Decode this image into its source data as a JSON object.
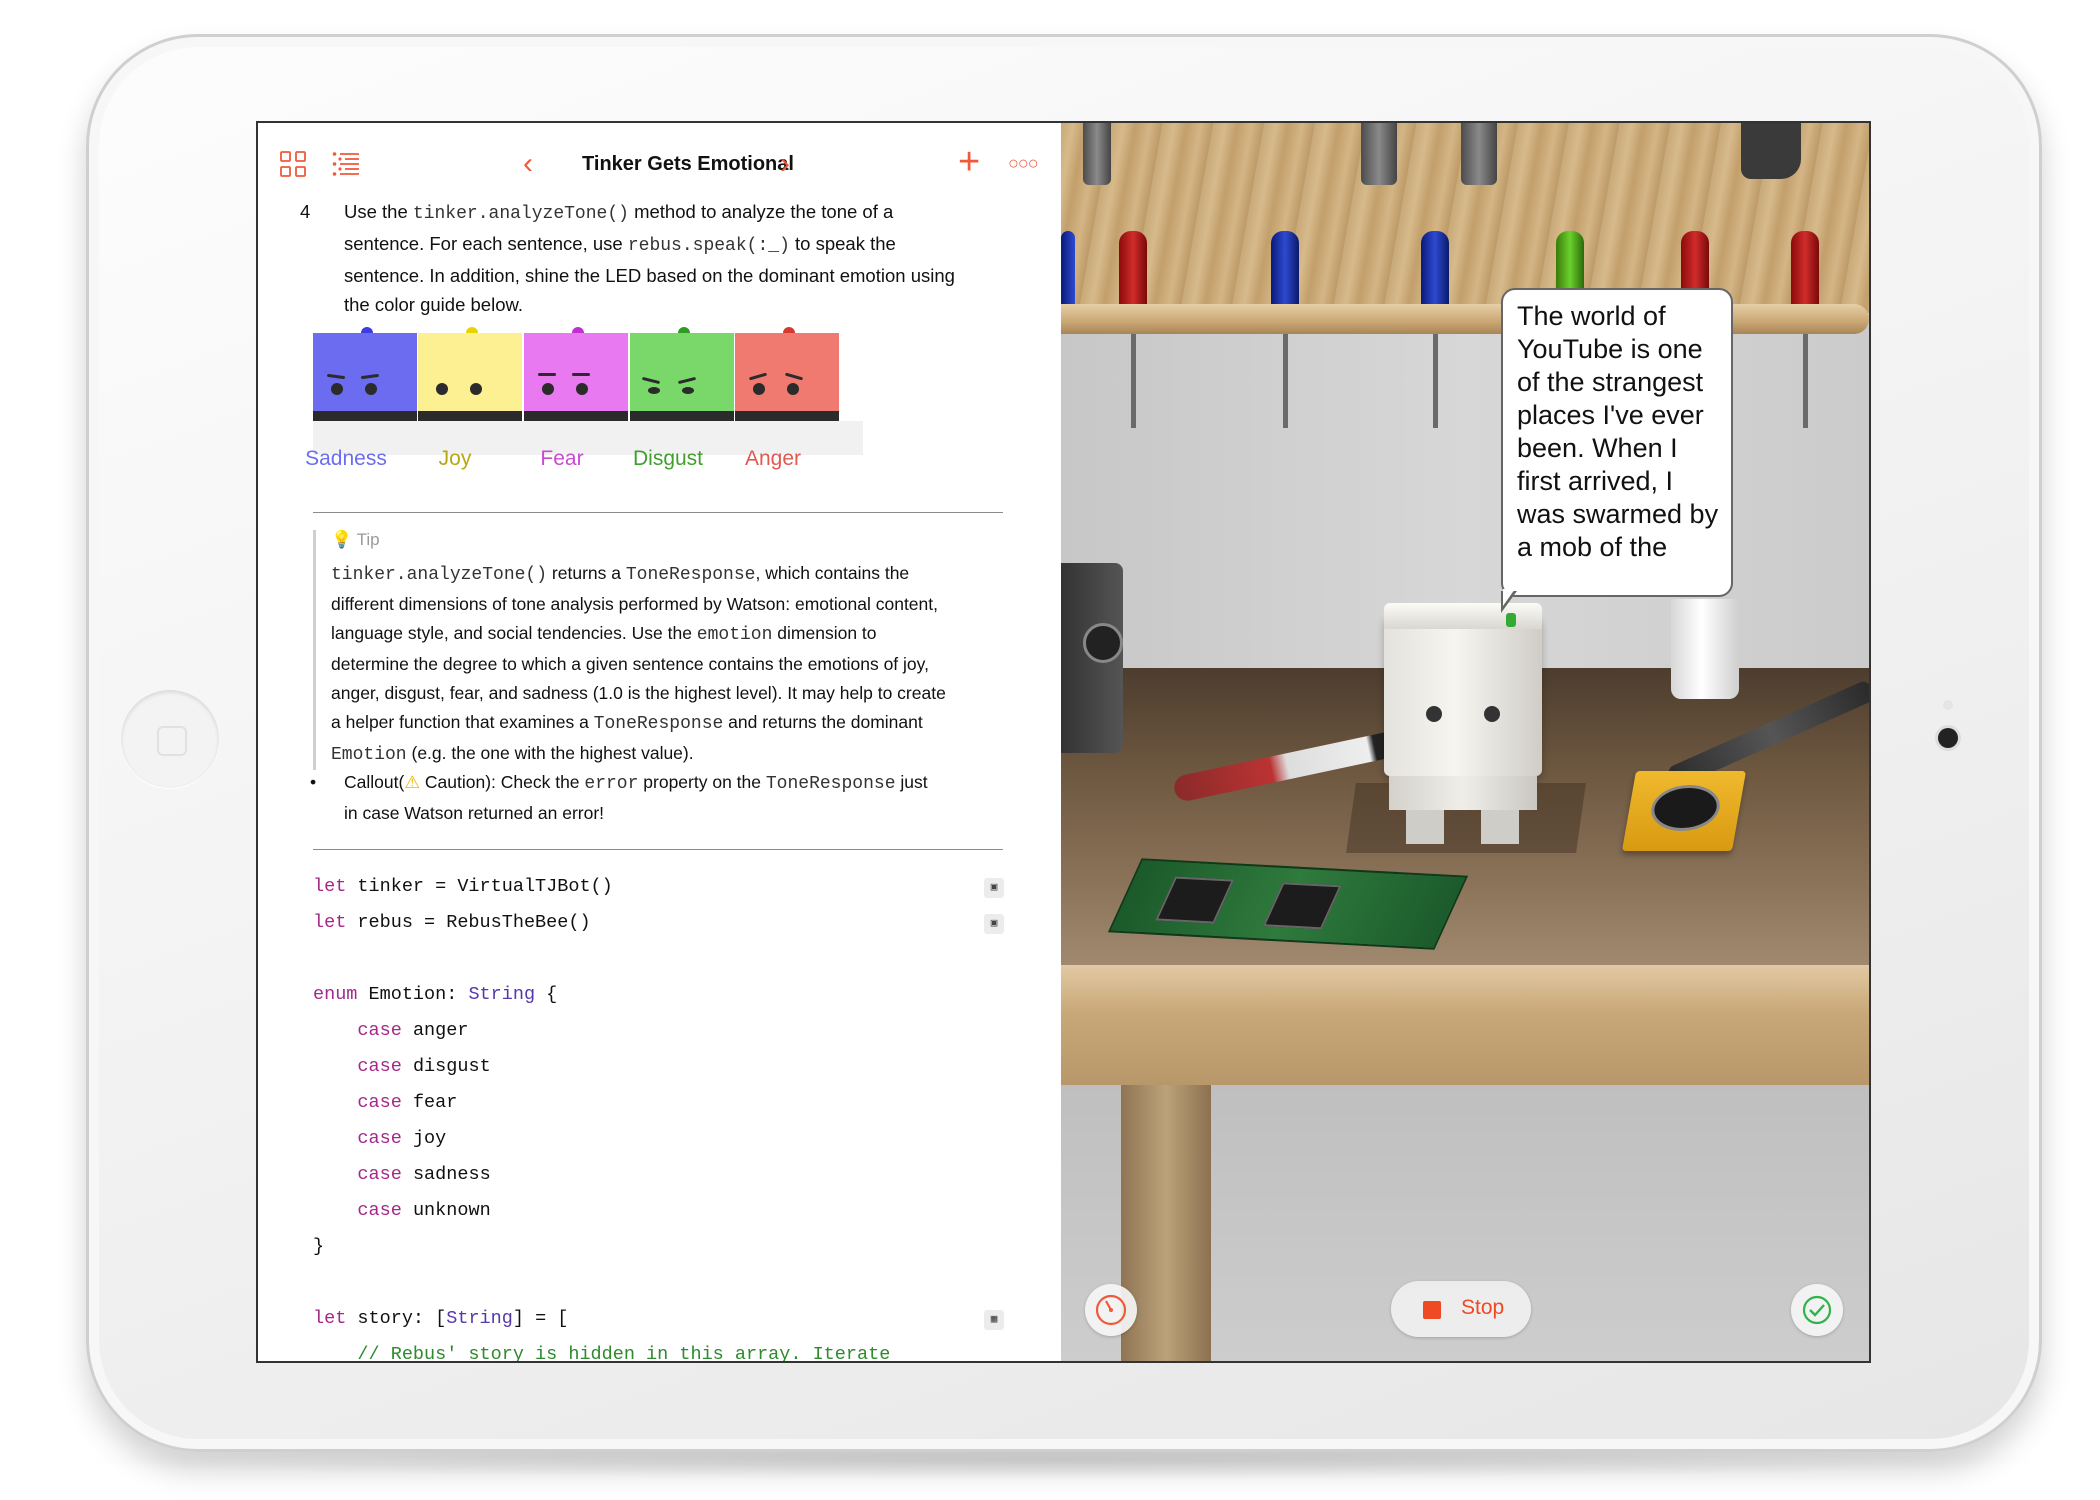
{
  "toolbar": {
    "title": "Tinker Gets Emotional",
    "icons": [
      "grid-icon",
      "list-icon",
      "chevron-left-icon",
      "chevron-right-icon",
      "plus-icon",
      "more-icon"
    ]
  },
  "step": {
    "number": "4",
    "line1_a": "Use the ",
    "line1_code": "tinker.analyzeTone()",
    "line1_b": " method to analyze the tone of a",
    "line2_a": "sentence. For each sentence, use ",
    "line2_code": "rebus.speak(:_)",
    "line2_b": " to speak the",
    "line3": "sentence. In addition, shine the LED based on the dominant emotion using",
    "line4": "the color guide below."
  },
  "emotions": [
    {
      "label": "Sadness",
      "color": "#6b6cf0",
      "text_color": "#6b6cf0",
      "led": "#3c3de0"
    },
    {
      "label": "Joy",
      "color": "#fdf093",
      "text_color": "#b9a712",
      "led": "#e6d400"
    },
    {
      "label": "Fear",
      "color": "#e879f0",
      "text_color": "#c94bd4",
      "led": "#c02fd0"
    },
    {
      "label": "Disgust",
      "color": "#7ad86a",
      "text_color": "#3fa02e",
      "led": "#2f9b22"
    },
    {
      "label": "Anger",
      "color": "#f07a70",
      "text_color": "#e05a50",
      "led": "#d43a30"
    }
  ],
  "tip": {
    "heading": "Tip",
    "l1_code1": "tinker.analyzeTone()",
    "l1_a": " returns a ",
    "l1_code2": "ToneResponse",
    "l1_b": ", which contains the",
    "l2": "different dimensions of tone analysis performed by Watson: emotional content,",
    "l3_a": "language style, and social tendencies. Use the ",
    "l3_code": "emotion",
    "l3_b": " dimension to",
    "l4": "determine the degree to which a given sentence contains the emotions of joy,",
    "l5": "anger, disgust, fear, and sadness (1.0 is the highest level). It may help to create",
    "l6_a": "a helper function that examines a ",
    "l6_code": "ToneResponse",
    "l6_b": " and returns the dominant",
    "l7_code": "Emotion",
    "l7_b": " (e.g. the one with the highest value)."
  },
  "callout": {
    "a": "Callout(",
    "icon": "warning-icon",
    "b": " Caution): Check the ",
    "code1": "error",
    "c": " property on the ",
    "code2": "ToneResponse",
    "d": " just",
    "line2": "in case Watson returned an error!"
  },
  "code": {
    "l1_kw": "let",
    "l1_rest": " tinker = VirtualTJBot()",
    "l2_kw": "let",
    "l2_rest": " rebus = RebusTheBee()",
    "l4_kw": "enum",
    "l4_mid": " Emotion: ",
    "l4_ty": "String",
    "l4_end": " {",
    "case_kw": "case",
    "cases": [
      "anger",
      "disgust",
      "fear",
      "joy",
      "sadness",
      "unknown"
    ],
    "close": "}",
    "l12_kw": "let",
    "l12_mid": " story: [",
    "l12_ty": "String",
    "l12_end": "] = [",
    "l13_comment": "    // Rebus' story is hidden in this array. Iterate"
  },
  "live_view": {
    "speech": "The world of YouTube is one of the strangest places I've ever been. When I first arrived, I was swarmed by a mob of the",
    "stop_label": "Stop",
    "left_button_icon": "speedometer-icon",
    "right_button_icon": "checkmark-icon"
  },
  "colors": {
    "accent": "#f05a3a",
    "keyword": "#a6278a",
    "type": "#5837a9",
    "comment": "#2d8a2d"
  }
}
